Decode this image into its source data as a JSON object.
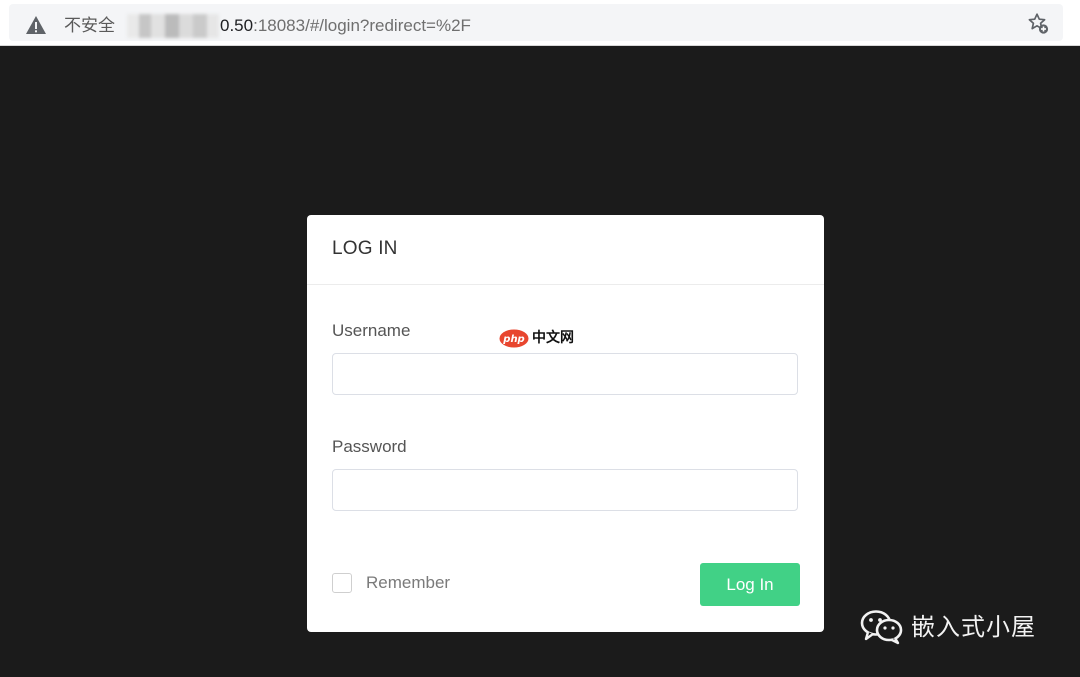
{
  "browser": {
    "security_label": "不安全",
    "url_host_tail": "0.50",
    "url_rest": ":18083/#/login?redirect=%2F"
  },
  "login": {
    "title": "LOG IN",
    "username_label": "Username",
    "username_value": "",
    "password_label": "Password",
    "password_value": "",
    "remember_label": "Remember",
    "remember_checked": false,
    "submit_label": "Log In"
  },
  "watermarks": {
    "php_logo_text": "php",
    "php_cn_text": "中文网",
    "wechat_account": "嵌入式小屋"
  },
  "colors": {
    "page_background": "#1b1b1b",
    "primary_button": "#41d186",
    "card_background": "#ffffff"
  }
}
